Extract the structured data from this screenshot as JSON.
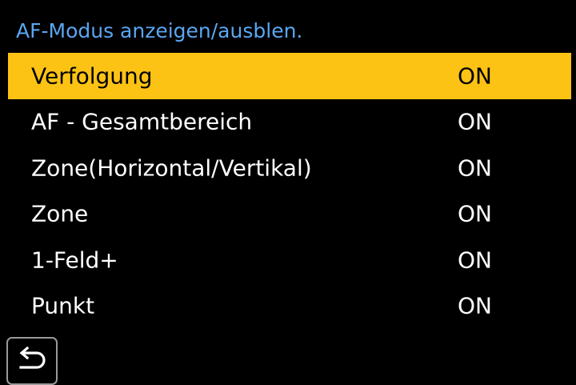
{
  "title": "AF-Modus anzeigen/ausblen.",
  "selected_index": 0,
  "colors": {
    "title": "#5aa6f2",
    "highlight": "#fcc315",
    "text": "#ffffff",
    "background": "#000000"
  },
  "items": [
    {
      "label": "Verfolgung",
      "value": "ON"
    },
    {
      "label": "AF - Gesamtbereich",
      "value": "ON"
    },
    {
      "label": "Zone(Horizontal/Vertikal)",
      "value": "ON"
    },
    {
      "label": "Zone",
      "value": "ON"
    },
    {
      "label": "1-Feld+",
      "value": "ON"
    },
    {
      "label": "Punkt",
      "value": "ON"
    }
  ],
  "back_button": {
    "icon": "return-arrow-icon"
  }
}
